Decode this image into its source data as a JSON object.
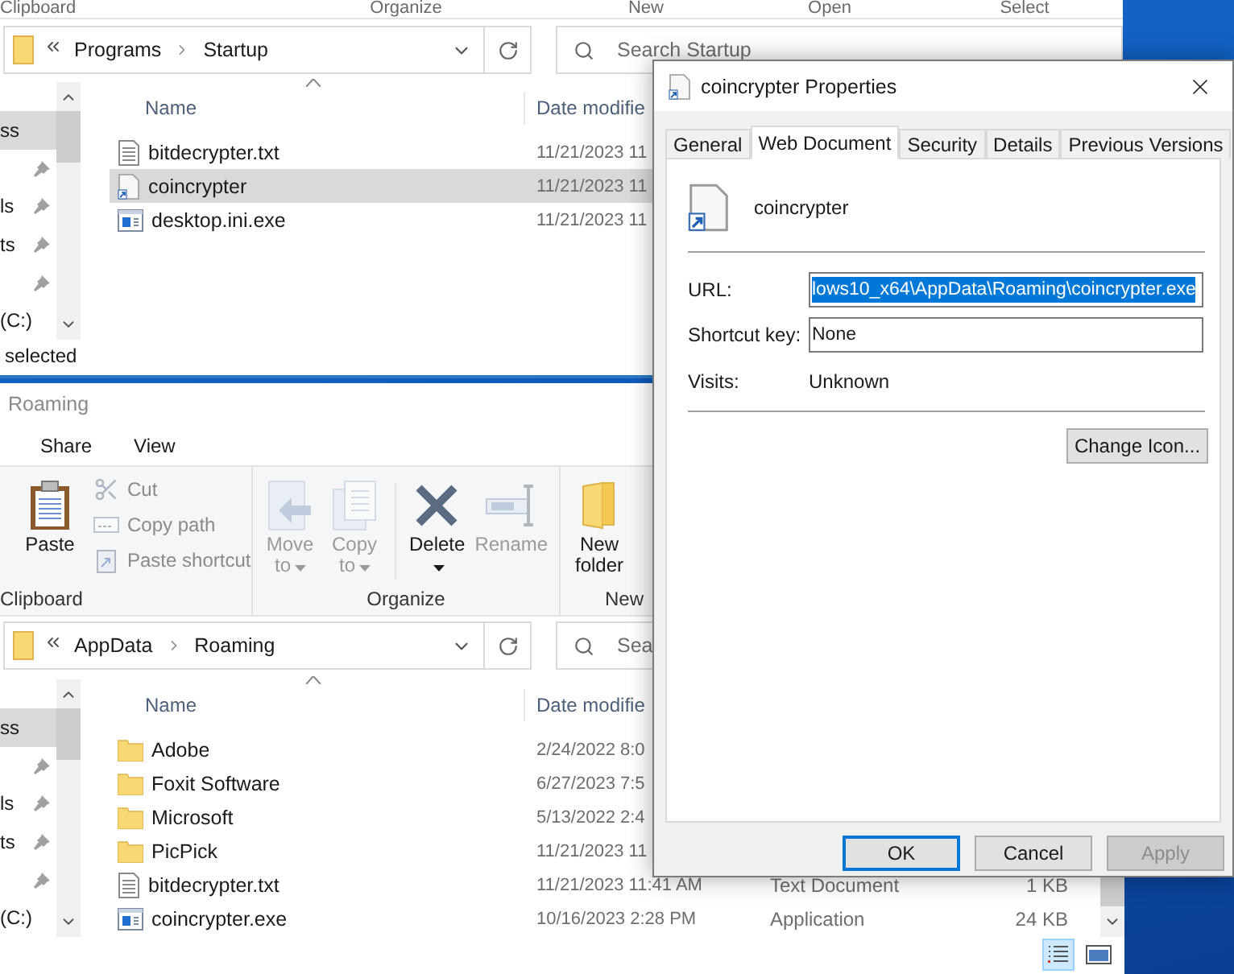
{
  "startup_window": {
    "ribbon_groups": [
      "Clipboard",
      "Organize",
      "New",
      "Open",
      "Select"
    ],
    "address": [
      "Programs",
      "Startup"
    ],
    "search": {
      "placeholder": "Search Startup"
    },
    "nav_items": [
      {
        "label": "ss",
        "pinned": false,
        "selected": true
      },
      {
        "pinned": true,
        "selected": false
      },
      {
        "label": "ls",
        "pinned": true,
        "selected": false
      },
      {
        "label": "ts",
        "pinned": true,
        "selected": false
      },
      {
        "pinned": true,
        "selected": false
      },
      {
        "label": "(C:)",
        "pinned": false,
        "selected": false
      }
    ],
    "columns": [
      "Name",
      "Date modifie"
    ],
    "rows": [
      {
        "kind": "text",
        "name": "bitdecrypter.txt",
        "date": "11/21/2023 11",
        "selected": false
      },
      {
        "kind": "shortcut",
        "name": "coincrypter",
        "date": "11/21/2023 11",
        "selected": true
      },
      {
        "kind": "exe",
        "name": "desktop.ini.exe",
        "date": "11/21/2023 11",
        "selected": false
      }
    ],
    "status": "selected"
  },
  "roaming_window": {
    "title": "Roaming",
    "tabs": [
      {
        "label": "Share",
        "selected": false
      },
      {
        "label": "View",
        "selected": false
      }
    ],
    "ribbon": [
      {
        "label": "Clipboard",
        "buttons": [
          {
            "kind": "large",
            "label": "Paste",
            "disabled": false,
            "dropdown": false
          },
          {
            "kind": "small",
            "label": "Cut",
            "disabled": true
          },
          {
            "kind": "small",
            "label": "Copy path",
            "disabled": true
          },
          {
            "kind": "small",
            "label": "Paste shortcut",
            "disabled": true
          }
        ]
      },
      {
        "label": "Organize",
        "buttons": [
          {
            "kind": "large",
            "label": "Move to",
            "disabled": true,
            "dropdown": true
          },
          {
            "kind": "large",
            "label": "Copy to",
            "disabled": true,
            "dropdown": true
          },
          {
            "kind": "large",
            "label": "Delete",
            "disabled": false,
            "dropdown": true
          },
          {
            "kind": "large",
            "label": "Rename",
            "disabled": true,
            "dropdown": false
          }
        ]
      },
      {
        "label": "New",
        "buttons": [
          {
            "kind": "large",
            "label": "New folder",
            "disabled": false,
            "dropdown": false
          }
        ]
      }
    ],
    "address": [
      "AppData",
      "Roaming"
    ],
    "search": {
      "placeholder": "Sea"
    },
    "nav_items": [
      {
        "label": "ss",
        "pinned": false,
        "selected": true
      },
      {
        "pinned": true,
        "selected": false
      },
      {
        "label": "ls",
        "pinned": true,
        "selected": false
      },
      {
        "label": "ts",
        "pinned": true,
        "selected": false
      },
      {
        "pinned": true,
        "selected": false
      },
      {
        "label": "(C:)",
        "pinned": false,
        "selected": false
      }
    ],
    "columns": [
      "Name",
      "Date modifie"
    ],
    "rows": [
      {
        "kind": "folder",
        "name": "Adobe",
        "date": "2/24/2022 8:0",
        "selected": false
      },
      {
        "kind": "folder",
        "name": "Foxit Software",
        "date": "6/27/2023 7:5",
        "selected": false
      },
      {
        "kind": "folder",
        "name": "Microsoft",
        "date": "5/13/2022 2:4",
        "selected": false
      },
      {
        "kind": "folder",
        "name": "PicPick",
        "date": "11/21/2023 11",
        "selected": false
      },
      {
        "kind": "text",
        "name": "bitdecrypter.txt",
        "date": "11/21/2023 11:41 AM",
        "type": "Text Document",
        "size": "1 KB",
        "selected": false
      },
      {
        "kind": "exe",
        "name": "coincrypter.exe",
        "date": "10/16/2023 2:28 PM",
        "type": "Application",
        "size": "24 KB",
        "selected": false
      }
    ],
    "view_modes": [
      {
        "kind": "details",
        "selected": true
      },
      {
        "kind": "large_icons",
        "selected": false
      }
    ]
  },
  "dialog": {
    "title": "coincrypter Properties",
    "tabs": [
      {
        "label": "General",
        "selected": false
      },
      {
        "label": "Web Document",
        "selected": true
      },
      {
        "label": "Security",
        "selected": false
      },
      {
        "label": "Details",
        "selected": false
      },
      {
        "label": "Previous Versions",
        "selected": false
      }
    ],
    "file_name": "coincrypter",
    "fields": [
      {
        "label": "URL:",
        "value": "lows10_x64\\AppData\\Roaming\\coincrypter.exe",
        "selected": true
      },
      {
        "label": "Shortcut key:",
        "value": "None",
        "selected": false
      }
    ],
    "visits": {
      "label": "Visits:",
      "value": "Unknown"
    },
    "change_icon": "Change Icon...",
    "buttons": [
      {
        "label": "OK",
        "default": true,
        "disabled": false
      },
      {
        "label": "Cancel",
        "default": false,
        "disabled": false
      },
      {
        "label": "Apply",
        "default": false,
        "disabled": true
      }
    ]
  }
}
